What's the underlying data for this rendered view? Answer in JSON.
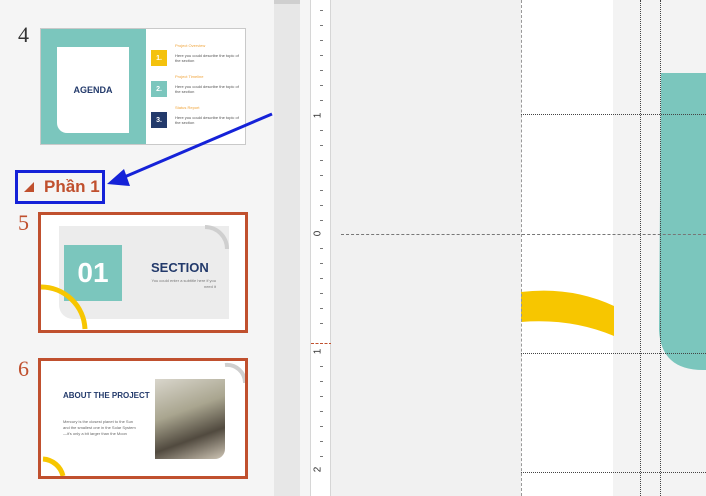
{
  "slides": [
    {
      "number": "4",
      "agenda": "AGENDA",
      "items": [
        {
          "num": "1.",
          "title": "Project Overview",
          "desc": "Here you could describe the topic of the section",
          "color": "#f4c20d"
        },
        {
          "num": "2.",
          "title": "Project Timeline",
          "desc": "Here you could describe the topic of the section",
          "color": "#7bc6bd"
        },
        {
          "num": "3.",
          "title": "Status Report",
          "desc": "Here you could describe the topic of the section",
          "color": "#233a6b"
        }
      ]
    },
    {
      "number": "5",
      "big": "01",
      "title": "SECTION",
      "subtitle": "You could enter a subtitle here if you need it"
    },
    {
      "number": "6",
      "title": "ABOUT THE PROJECT",
      "body": "Mercury is the closest planet to the Sun and the smallest one in the Solar System—it's only a bit larger than the Moon"
    }
  ],
  "section": {
    "label": "Phần 1"
  },
  "ruler": {
    "labels": [
      "1",
      "0",
      "1",
      "2"
    ]
  },
  "colors": {
    "teal": "#7bc6bd",
    "yellow": "#f7c600",
    "selection": "#c0502e",
    "callout": "#1522d8",
    "navy": "#233a6b"
  }
}
